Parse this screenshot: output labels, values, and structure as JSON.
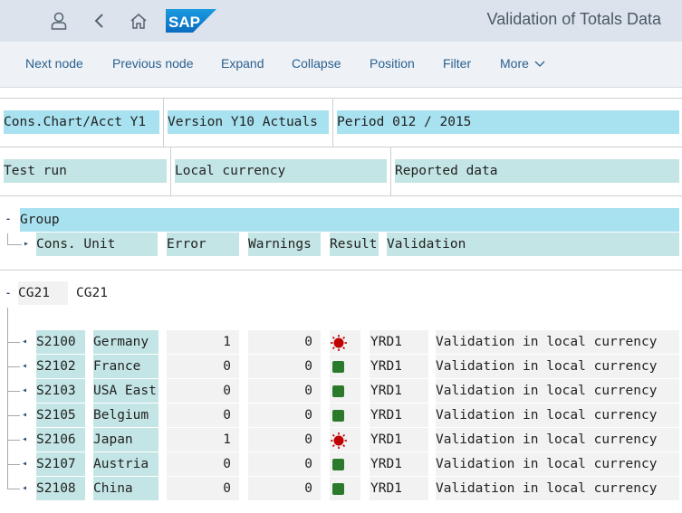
{
  "app": {
    "title": "Validation of Totals Data"
  },
  "toolbar": {
    "next_node": "Next node",
    "previous_node": "Previous node",
    "expand": "Expand",
    "collapse": "Collapse",
    "position": "Position",
    "filter": "Filter",
    "more": "More"
  },
  "header": {
    "chart": "Cons.Chart/Acct  Y1",
    "version": "Version  Y10 Actuals",
    "period": "Period 012 / 2015",
    "run": "Test run",
    "currency": "Local currency",
    "data": "Reported data"
  },
  "columns": {
    "group": "Group",
    "unit": "Cons. Unit",
    "error": "Error",
    "warnings": "Warnings",
    "result": "Result",
    "validation": "Validation"
  },
  "group_node": {
    "code": "CG21",
    "name": "CG21"
  },
  "rows": [
    {
      "unit": "S2100",
      "name": "Germany",
      "error": "1",
      "warnings": "0",
      "status": "error",
      "val_code": "YRD1",
      "val_text": "Validation in local currency"
    },
    {
      "unit": "S2102",
      "name": "France",
      "error": "0",
      "warnings": "0",
      "status": "ok",
      "val_code": "YRD1",
      "val_text": "Validation in local currency"
    },
    {
      "unit": "S2103",
      "name": "USA East",
      "error": "0",
      "warnings": "0",
      "status": "ok",
      "val_code": "YRD1",
      "val_text": "Validation in local currency"
    },
    {
      "unit": "S2105",
      "name": "Belgium",
      "error": "0",
      "warnings": "0",
      "status": "ok",
      "val_code": "YRD1",
      "val_text": "Validation in local currency"
    },
    {
      "unit": "S2106",
      "name": "Japan",
      "error": "1",
      "warnings": "0",
      "status": "error",
      "val_code": "YRD1",
      "val_text": "Validation in local currency"
    },
    {
      "unit": "S2107",
      "name": "Austria",
      "error": "0",
      "warnings": "0",
      "status": "ok",
      "val_code": "YRD1",
      "val_text": "Validation in local currency"
    },
    {
      "unit": "S2108",
      "name": "China",
      "error": "0",
      "warnings": "0",
      "status": "ok",
      "val_code": "YRD1",
      "val_text": "Validation in local currency"
    }
  ],
  "colors": {
    "blue_field": "#a8e1ef",
    "teal_field": "#c4e5e5",
    "ok": "#2b7a2b",
    "error": "#c00000"
  }
}
